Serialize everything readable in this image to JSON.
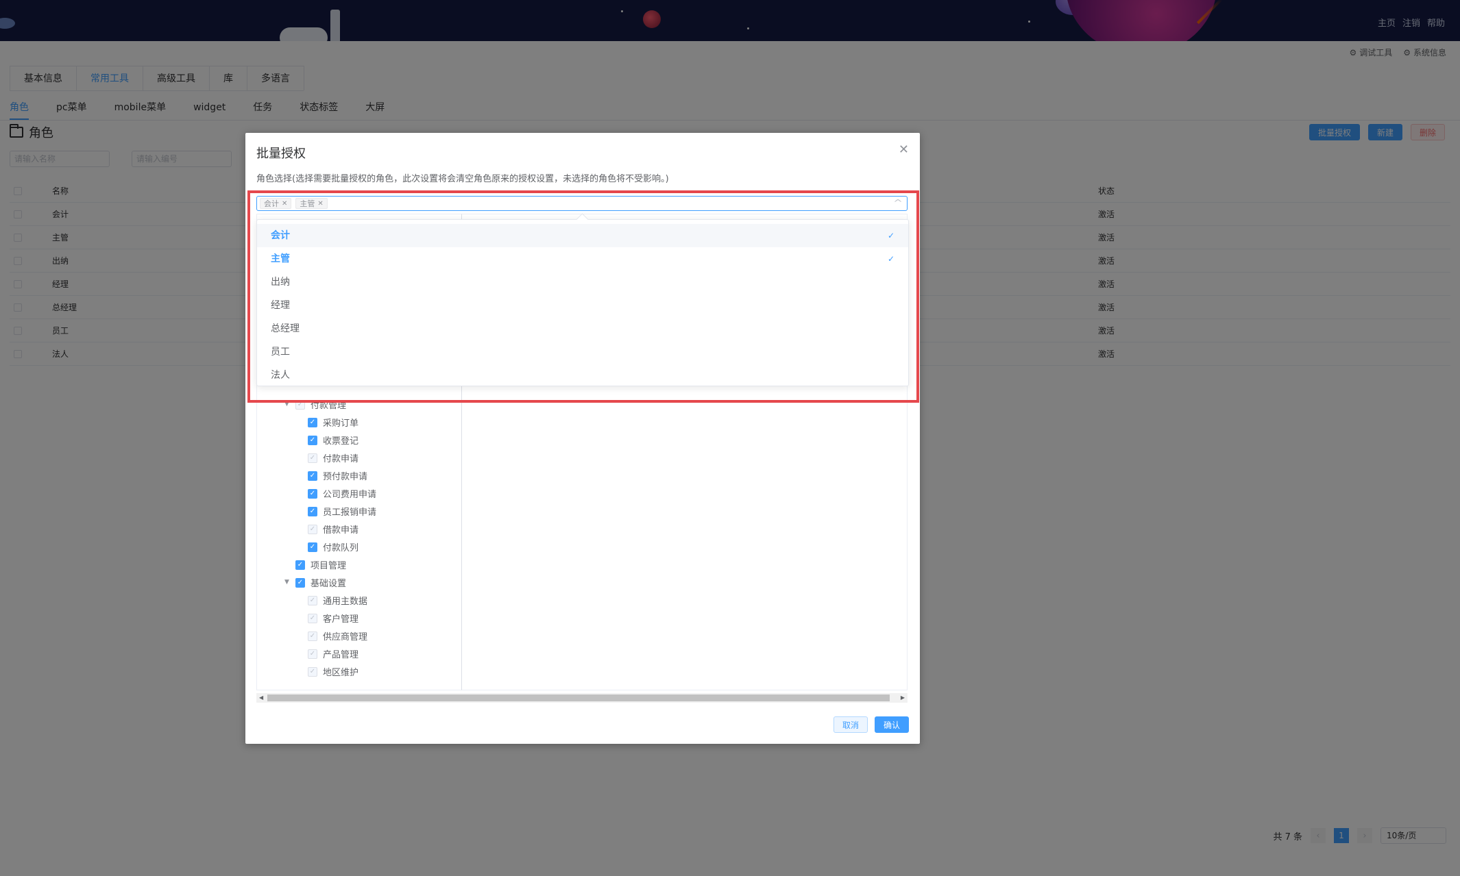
{
  "header": {
    "links": [
      "主页",
      "注销",
      "帮助"
    ]
  },
  "sysbar": {
    "debug": "调试工具",
    "sysinfo": "系统信息"
  },
  "top_tabs": [
    "基本信息",
    "常用工具",
    "高级工具",
    "库",
    "多语言"
  ],
  "sub_tabs": [
    "角色",
    "pc菜单",
    "mobile菜单",
    "widget",
    "任务",
    "状态标签",
    "大屏"
  ],
  "page": {
    "title": "角色",
    "actions": {
      "batch": "批量授权",
      "new": "新建",
      "delete": "删除"
    },
    "filters": {
      "name_placeholder": "请输入名称",
      "code_placeholder": "请输入编号"
    },
    "table": {
      "headers": {
        "name": "名称",
        "status": "状态"
      },
      "rows": [
        {
          "name": "会计",
          "status": "激活"
        },
        {
          "name": "主管",
          "status": "激活"
        },
        {
          "name": "出纳",
          "status": "激活"
        },
        {
          "name": "经理",
          "status": "激活"
        },
        {
          "name": "总经理",
          "status": "激活"
        },
        {
          "name": "员工",
          "status": "激活"
        },
        {
          "name": "法人",
          "status": "激活"
        }
      ]
    },
    "pager": {
      "total": "共 7 条",
      "current": "1",
      "size": "10条/页"
    }
  },
  "dialog": {
    "title": "批量授权",
    "description": "角色选择(选择需要批量授权的角色，此次设置将会清空角色原来的授权设置，未选择的角色将不受影响。)",
    "selected_tags": [
      "会计",
      "主管"
    ],
    "options": [
      {
        "label": "会计",
        "selected": true
      },
      {
        "label": "主管",
        "selected": true
      },
      {
        "label": "出纳",
        "selected": false
      },
      {
        "label": "经理",
        "selected": false
      },
      {
        "label": "总经理",
        "selected": false
      },
      {
        "label": "员工",
        "selected": false
      },
      {
        "label": "法人",
        "selected": false
      }
    ],
    "tree": [
      {
        "label": "付款管理",
        "level": 1,
        "checked": "half"
      },
      {
        "label": "采购订单",
        "level": 2,
        "checked": true
      },
      {
        "label": "收票登记",
        "level": 2,
        "checked": true
      },
      {
        "label": "付款申请",
        "level": 2,
        "checked": false
      },
      {
        "label": "预付款申请",
        "level": 2,
        "checked": true
      },
      {
        "label": "公司费用申请",
        "level": 2,
        "checked": true
      },
      {
        "label": "员工报销申请",
        "level": 2,
        "checked": true
      },
      {
        "label": "借款申请",
        "level": 2,
        "checked": false
      },
      {
        "label": "付款队列",
        "level": 2,
        "checked": true
      },
      {
        "label": "项目管理",
        "level": 1,
        "checked": true
      },
      {
        "label": "基础设置",
        "level": 1,
        "checked": true
      },
      {
        "label": "通用主数据",
        "level": 2,
        "checked": false
      },
      {
        "label": "客户管理",
        "level": 2,
        "checked": false
      },
      {
        "label": "供应商管理",
        "level": 2,
        "checked": false
      },
      {
        "label": "产品管理",
        "level": 2,
        "checked": false
      },
      {
        "label": "地区维护",
        "level": 2,
        "checked": false
      }
    ],
    "footer": {
      "cancel": "取消",
      "confirm": "确认"
    }
  }
}
